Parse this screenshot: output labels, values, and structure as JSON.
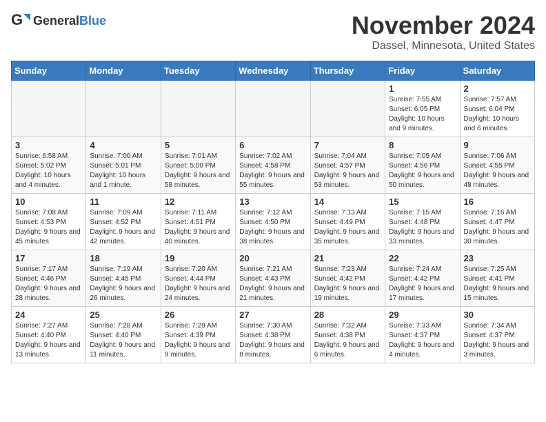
{
  "logo": {
    "text_general": "General",
    "text_blue": "Blue"
  },
  "title": "November 2024",
  "location": "Dassel, Minnesota, United States",
  "days_of_week": [
    "Sunday",
    "Monday",
    "Tuesday",
    "Wednesday",
    "Thursday",
    "Friday",
    "Saturday"
  ],
  "weeks": [
    [
      {
        "day": "",
        "info": ""
      },
      {
        "day": "",
        "info": ""
      },
      {
        "day": "",
        "info": ""
      },
      {
        "day": "",
        "info": ""
      },
      {
        "day": "",
        "info": ""
      },
      {
        "day": "1",
        "info": "Sunrise: 7:55 AM\nSunset: 6:05 PM\nDaylight: 10 hours and 9 minutes."
      },
      {
        "day": "2",
        "info": "Sunrise: 7:57 AM\nSunset: 6:04 PM\nDaylight: 10 hours and 6 minutes."
      }
    ],
    [
      {
        "day": "3",
        "info": "Sunrise: 6:58 AM\nSunset: 5:02 PM\nDaylight: 10 hours and 4 minutes."
      },
      {
        "day": "4",
        "info": "Sunrise: 7:00 AM\nSunset: 5:01 PM\nDaylight: 10 hours and 1 minute."
      },
      {
        "day": "5",
        "info": "Sunrise: 7:01 AM\nSunset: 5:00 PM\nDaylight: 9 hours and 58 minutes."
      },
      {
        "day": "6",
        "info": "Sunrise: 7:02 AM\nSunset: 4:58 PM\nDaylight: 9 hours and 55 minutes."
      },
      {
        "day": "7",
        "info": "Sunrise: 7:04 AM\nSunset: 4:57 PM\nDaylight: 9 hours and 53 minutes."
      },
      {
        "day": "8",
        "info": "Sunrise: 7:05 AM\nSunset: 4:56 PM\nDaylight: 9 hours and 50 minutes."
      },
      {
        "day": "9",
        "info": "Sunrise: 7:06 AM\nSunset: 4:55 PM\nDaylight: 9 hours and 48 minutes."
      }
    ],
    [
      {
        "day": "10",
        "info": "Sunrise: 7:08 AM\nSunset: 4:53 PM\nDaylight: 9 hours and 45 minutes."
      },
      {
        "day": "11",
        "info": "Sunrise: 7:09 AM\nSunset: 4:52 PM\nDaylight: 9 hours and 42 minutes."
      },
      {
        "day": "12",
        "info": "Sunrise: 7:11 AM\nSunset: 4:51 PM\nDaylight: 9 hours and 40 minutes."
      },
      {
        "day": "13",
        "info": "Sunrise: 7:12 AM\nSunset: 4:50 PM\nDaylight: 9 hours and 38 minutes."
      },
      {
        "day": "14",
        "info": "Sunrise: 7:13 AM\nSunset: 4:49 PM\nDaylight: 9 hours and 35 minutes."
      },
      {
        "day": "15",
        "info": "Sunrise: 7:15 AM\nSunset: 4:48 PM\nDaylight: 9 hours and 33 minutes."
      },
      {
        "day": "16",
        "info": "Sunrise: 7:16 AM\nSunset: 4:47 PM\nDaylight: 9 hours and 30 minutes."
      }
    ],
    [
      {
        "day": "17",
        "info": "Sunrise: 7:17 AM\nSunset: 4:46 PM\nDaylight: 9 hours and 28 minutes."
      },
      {
        "day": "18",
        "info": "Sunrise: 7:19 AM\nSunset: 4:45 PM\nDaylight: 9 hours and 26 minutes."
      },
      {
        "day": "19",
        "info": "Sunrise: 7:20 AM\nSunset: 4:44 PM\nDaylight: 9 hours and 24 minutes."
      },
      {
        "day": "20",
        "info": "Sunrise: 7:21 AM\nSunset: 4:43 PM\nDaylight: 9 hours and 21 minutes."
      },
      {
        "day": "21",
        "info": "Sunrise: 7:23 AM\nSunset: 4:42 PM\nDaylight: 9 hours and 19 minutes."
      },
      {
        "day": "22",
        "info": "Sunrise: 7:24 AM\nSunset: 4:42 PM\nDaylight: 9 hours and 17 minutes."
      },
      {
        "day": "23",
        "info": "Sunrise: 7:25 AM\nSunset: 4:41 PM\nDaylight: 9 hours and 15 minutes."
      }
    ],
    [
      {
        "day": "24",
        "info": "Sunrise: 7:27 AM\nSunset: 4:40 PM\nDaylight: 9 hours and 13 minutes."
      },
      {
        "day": "25",
        "info": "Sunrise: 7:28 AM\nSunset: 4:40 PM\nDaylight: 9 hours and 11 minutes."
      },
      {
        "day": "26",
        "info": "Sunrise: 7:29 AM\nSunset: 4:39 PM\nDaylight: 9 hours and 9 minutes."
      },
      {
        "day": "27",
        "info": "Sunrise: 7:30 AM\nSunset: 4:38 PM\nDaylight: 9 hours and 8 minutes."
      },
      {
        "day": "28",
        "info": "Sunrise: 7:32 AM\nSunset: 4:38 PM\nDaylight: 9 hours and 6 minutes."
      },
      {
        "day": "29",
        "info": "Sunrise: 7:33 AM\nSunset: 4:37 PM\nDaylight: 9 hours and 4 minutes."
      },
      {
        "day": "30",
        "info": "Sunrise: 7:34 AM\nSunset: 4:37 PM\nDaylight: 9 hours and 3 minutes."
      }
    ]
  ]
}
